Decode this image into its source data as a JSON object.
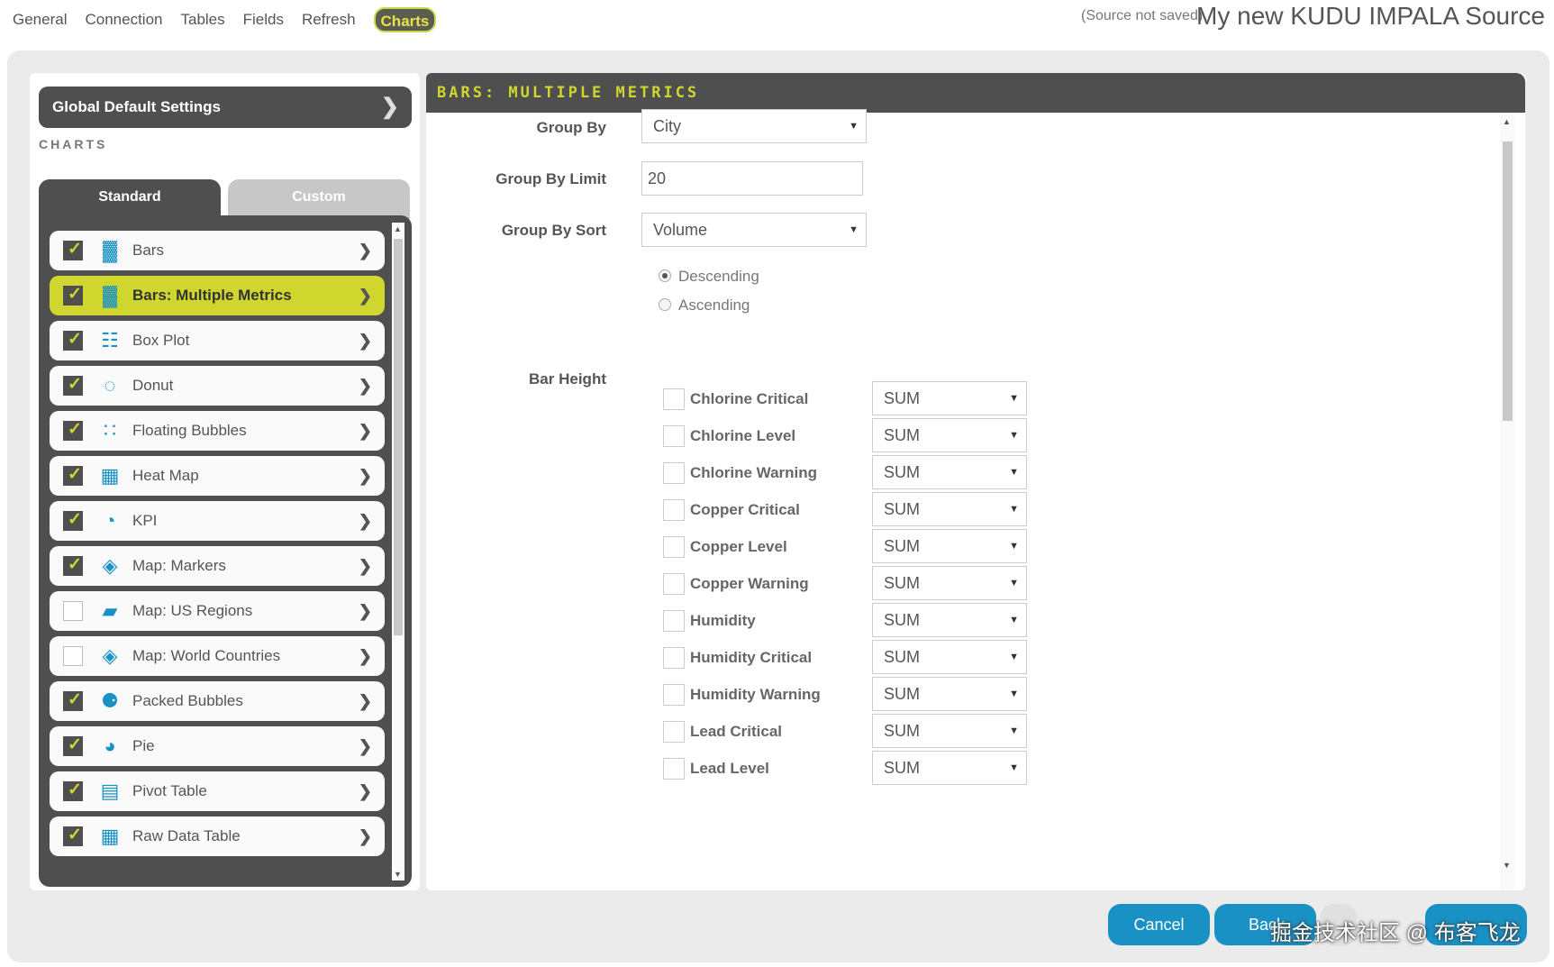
{
  "topnav": {
    "tabs": [
      "General",
      "Connection",
      "Tables",
      "Fields",
      "Refresh",
      "Charts"
    ],
    "active_tab": "Charts",
    "source_status": "(Source not saved)",
    "source_name": "My new KUDU IMPALA Source"
  },
  "left": {
    "global_defaults_label": "Global Default Settings",
    "charts_heading": "CHARTS",
    "tabs": {
      "standard": "Standard",
      "custom": "Custom"
    },
    "items": [
      {
        "label": "Bars",
        "icon": "bar-chart-icon",
        "checked": true,
        "active": false
      },
      {
        "label": "Bars: Multiple Metrics",
        "icon": "bar-chart-icon",
        "checked": true,
        "active": true
      },
      {
        "label": "Box Plot",
        "icon": "box-plot-icon",
        "checked": true,
        "active": false
      },
      {
        "label": "Donut",
        "icon": "donut-icon",
        "checked": true,
        "active": false
      },
      {
        "label": "Floating Bubbles",
        "icon": "floating-bubbles-icon",
        "checked": true,
        "active": false
      },
      {
        "label": "Heat Map",
        "icon": "heat-map-icon",
        "checked": true,
        "active": false
      },
      {
        "label": "KPI",
        "icon": "gauge-icon",
        "checked": true,
        "active": false
      },
      {
        "label": "Map: Markers",
        "icon": "world-map-icon",
        "checked": true,
        "active": false
      },
      {
        "label": "Map: US Regions",
        "icon": "us-map-icon",
        "checked": false,
        "active": false
      },
      {
        "label": "Map: World Countries",
        "icon": "world-map-icon",
        "checked": false,
        "active": false
      },
      {
        "label": "Packed Bubbles",
        "icon": "packed-bubbles-icon",
        "checked": true,
        "active": false
      },
      {
        "label": "Pie",
        "icon": "pie-icon",
        "checked": true,
        "active": false
      },
      {
        "label": "Pivot Table",
        "icon": "pivot-table-icon",
        "checked": true,
        "active": false
      },
      {
        "label": "Raw Data Table",
        "icon": "table-icon",
        "checked": true,
        "active": false
      }
    ]
  },
  "right": {
    "title": "BARS: MULTIPLE METRICS",
    "group_by_label": "Group By",
    "group_by_value": "City",
    "group_by_limit_label": "Group By Limit",
    "group_by_limit_value": "20",
    "group_by_sort_label": "Group By Sort",
    "group_by_sort_value": "Volume",
    "sort_options": [
      {
        "label": "Descending",
        "selected": true
      },
      {
        "label": "Ascending",
        "selected": false
      }
    ],
    "bar_height_label": "Bar Height",
    "metrics": [
      {
        "label": "Chlorine Critical",
        "agg": "SUM"
      },
      {
        "label": "Chlorine Level",
        "agg": "SUM"
      },
      {
        "label": "Chlorine Warning",
        "agg": "SUM"
      },
      {
        "label": "Copper Critical",
        "agg": "SUM"
      },
      {
        "label": "Copper Level",
        "agg": "SUM"
      },
      {
        "label": "Copper Warning",
        "agg": "SUM"
      },
      {
        "label": "Humidity",
        "agg": "SUM"
      },
      {
        "label": "Humidity Critical",
        "agg": "SUM"
      },
      {
        "label": "Humidity Warning",
        "agg": "SUM"
      },
      {
        "label": "Lead Critical",
        "agg": "SUM"
      },
      {
        "label": "Lead Level",
        "agg": "SUM"
      }
    ]
  },
  "buttons": {
    "cancel": "Cancel",
    "back": "Back"
  },
  "watermark": "掘金技术社区 @ 布客飞龙",
  "colors": {
    "accent": "#cfd62d",
    "dark": "#4f4f4f",
    "button_blue": "#1a91c5",
    "icon_blue": "#1a91c5"
  }
}
